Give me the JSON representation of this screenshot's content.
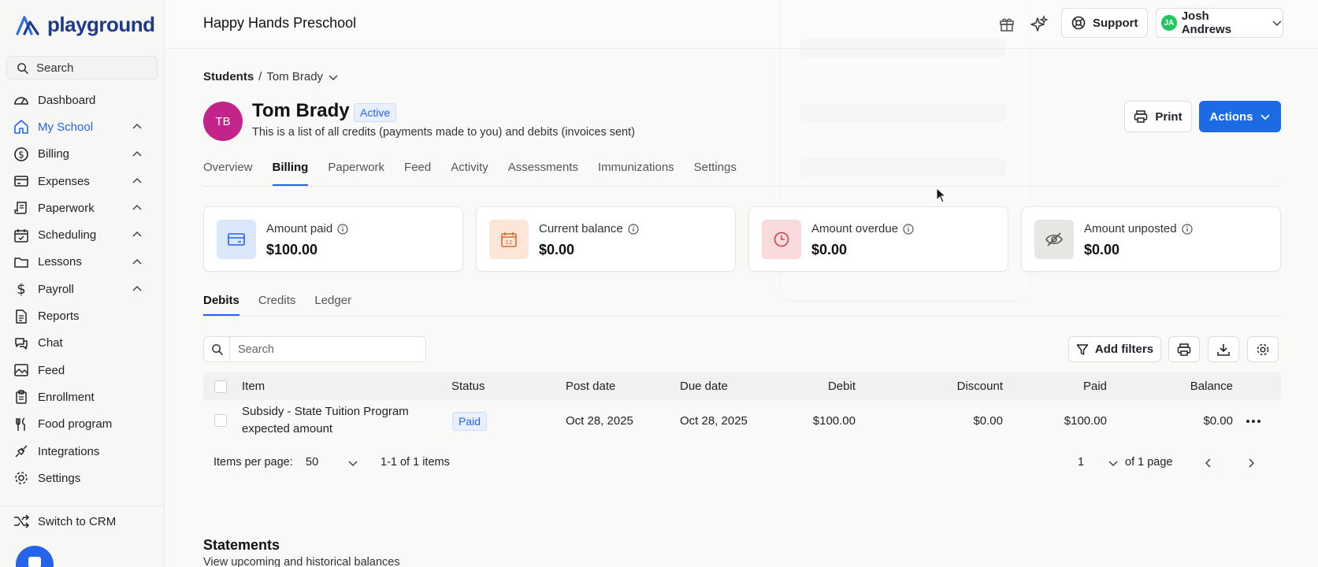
{
  "brand": {
    "name": "playground",
    "color": "#1e3a8a"
  },
  "sidebar": {
    "search_label": "Search",
    "items": [
      {
        "label": "Dashboard",
        "icon": "gauge-icon",
        "expandable": false
      },
      {
        "label": "My School",
        "icon": "home-icon",
        "expandable": true,
        "active": true
      },
      {
        "label": "Billing",
        "icon": "dollar-circle-icon",
        "expandable": true
      },
      {
        "label": "Expenses",
        "icon": "card-icon",
        "expandable": true
      },
      {
        "label": "Paperwork",
        "icon": "scroll-icon",
        "expandable": true
      },
      {
        "label": "Scheduling",
        "icon": "calendar-check-icon",
        "expandable": true
      },
      {
        "label": "Lessons",
        "icon": "folder-icon",
        "expandable": true
      },
      {
        "label": "Payroll",
        "icon": "dollar-icon",
        "expandable": true
      },
      {
        "label": "Reports",
        "icon": "document-icon",
        "expandable": false
      },
      {
        "label": "Chat",
        "icon": "chat-icon",
        "expandable": false
      },
      {
        "label": "Feed",
        "icon": "image-icon",
        "expandable": false
      },
      {
        "label": "Enrollment",
        "icon": "clipboard-icon",
        "expandable": false
      },
      {
        "label": "Food program",
        "icon": "utensils-icon",
        "expandable": false
      },
      {
        "label": "Integrations",
        "icon": "plug-icon",
        "expandable": false
      },
      {
        "label": "Settings",
        "icon": "gear-icon",
        "expandable": false
      }
    ],
    "switch_label": "Switch to CRM"
  },
  "topbar": {
    "school_name": "Happy Hands Preschool",
    "support_label": "Support",
    "user_initials": "JA",
    "user_name": "Josh Andrews"
  },
  "breadcrumb": {
    "parent": "Students",
    "separator": "/",
    "current": "Tom Brady"
  },
  "student": {
    "initials": "TB",
    "name": "Tom Brady",
    "status": "Active",
    "description": "This is a list of all credits (payments made to you) and debits (invoices sent)"
  },
  "buttons": {
    "print": "Print",
    "actions": "Actions",
    "add_filters": "Add filters"
  },
  "tabs": [
    "Overview",
    "Billing",
    "Paperwork",
    "Feed",
    "Activity",
    "Assessments",
    "Immunizations",
    "Settings"
  ],
  "active_tab": "Billing",
  "summary_cards": [
    {
      "label": "Amount paid",
      "value": "$100.00",
      "icon": "credit-card-icon",
      "bg": "#dbe7fb",
      "fg": "#2563eb"
    },
    {
      "label": "Current balance",
      "value": "$0.00",
      "icon": "calendar-icon",
      "bg": "#fbe6d9",
      "fg": "#d9692b"
    },
    {
      "label": "Amount overdue",
      "value": "$0.00",
      "icon": "clock-icon",
      "bg": "#f9dadd",
      "fg": "#d43c4c"
    },
    {
      "label": "Amount unposted",
      "value": "$0.00",
      "icon": "eye-off-icon",
      "bg": "#e6e6e3",
      "fg": "#555555"
    }
  ],
  "subtabs": [
    "Debits",
    "Credits",
    "Ledger"
  ],
  "table": {
    "search_placeholder": "Search",
    "columns": [
      "Item",
      "Status",
      "Post date",
      "Due date",
      "Debit",
      "Discount",
      "Paid",
      "Balance"
    ],
    "rows": [
      {
        "item_line1": "Subsidy - State Tuition Program",
        "item_line2": "expected amount",
        "status": "Paid",
        "post_date": "Oct 28, 2025",
        "due_date": "Oct 28, 2025",
        "debit": "$100.00",
        "discount": "$0.00",
        "paid": "$100.00",
        "balance": "$0.00"
      }
    ],
    "pagination": {
      "items_per_page_label": "Items per page:",
      "items_per_page": "50",
      "range": "1-1 of 1 items",
      "page": "1",
      "of_pages": "of 1 page"
    }
  },
  "statements": {
    "title": "Statements",
    "subtitle": "View upcoming and historical balances"
  }
}
